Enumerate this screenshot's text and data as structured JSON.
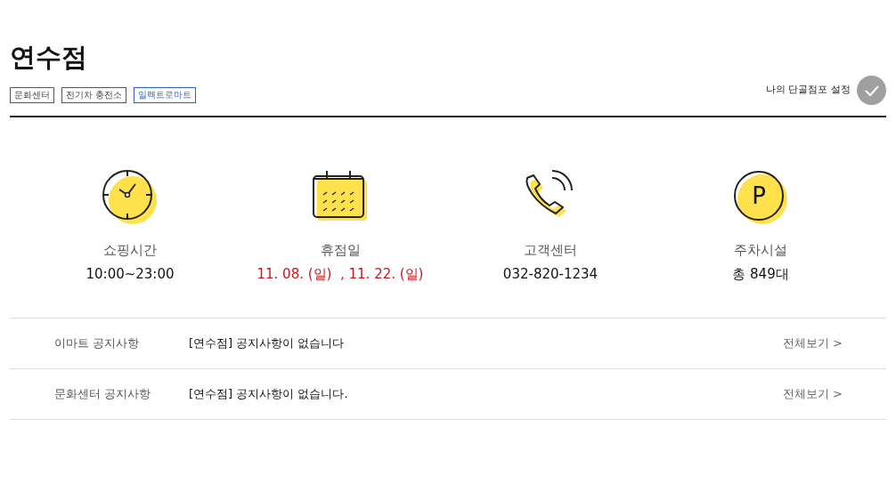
{
  "store": {
    "title": "연수점",
    "tags": [
      {
        "label": "문화센터",
        "highlighted": false
      },
      {
        "label": "전기차 충전소",
        "highlighted": false
      },
      {
        "label": "일렉트로마트",
        "highlighted": true
      }
    ],
    "favorite": {
      "label": "나의 단골점포 설정"
    }
  },
  "info": [
    {
      "kind": "clock",
      "label": "쇼핑시간",
      "value": "10:00~23:00",
      "alert": false
    },
    {
      "kind": "calendar",
      "label": "휴점일",
      "value": "11. 08. (일)  , 11. 22. (일)",
      "alert": true
    },
    {
      "kind": "phone",
      "label": "고객센터",
      "value": "032-820-1234",
      "alert": false
    },
    {
      "kind": "parking",
      "label": "주차시설",
      "value": "총 849대",
      "alert": false,
      "icon_text": "P"
    }
  ],
  "notices": [
    {
      "category": "이마트 공지사항",
      "message": "[연수점] 공지사항이 없습니다",
      "link": "전체보기 >"
    },
    {
      "category": "문화센터 공지사항",
      "message": "[연수점] 공지사항이 없습니다.",
      "link": "전체보기 >"
    }
  ]
}
